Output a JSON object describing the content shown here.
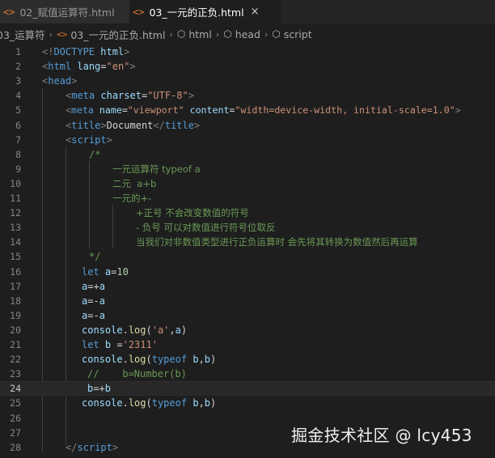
{
  "tabs": [
    {
      "label": "02_赋值运算符.html",
      "state": "inactive"
    },
    {
      "label": "03_一元的正负.html",
      "state": "active",
      "close": "×"
    }
  ],
  "breadcrumb": {
    "folder": "03_运算符",
    "file": "03_一元的正负.html",
    "items": [
      "html",
      "head",
      "script"
    ]
  },
  "icons": {
    "html_file": "<>",
    "symbol_cube": "⬡",
    "separator": "›"
  },
  "line_numbers": [
    "1",
    "2",
    "3",
    "4",
    "5",
    "6",
    "7",
    "8",
    "9",
    "10",
    "11",
    "12",
    "13",
    "14",
    "15",
    "16",
    "17",
    "18",
    "19",
    "20",
    "21",
    "22",
    "23",
    "24",
    "25",
    "26",
    "27",
    "28"
  ],
  "current_line": "24",
  "code": {
    "l1": {
      "open": "<!",
      "tag": "DOCTYPE",
      "rest": " html",
      "close": ">"
    },
    "l2": {
      "open": "<",
      "tag": "html",
      "attr": "lang",
      "eq": "=",
      "val": "\"en\"",
      "close": ">"
    },
    "l3": {
      "open": "<",
      "tag": "head",
      "close": ">"
    },
    "l4": {
      "open": "<",
      "tag": "meta",
      "attr": "charset",
      "eq": "=",
      "val": "\"UTF-8\"",
      "close": ">"
    },
    "l5": {
      "open": "<",
      "tag": "meta",
      "attr1": "name",
      "eq1": "=",
      "val1": "\"viewport\"",
      "attr2": "content",
      "eq2": "=",
      "val2": "\"width=device-width, initial-scale=1.0\"",
      "close": ">"
    },
    "l6": {
      "open": "<",
      "tag": "title",
      "close": ">",
      "text": "Document",
      "open2": "</",
      "tag2": "title",
      "close2": ">"
    },
    "l7": {
      "open": "<",
      "tag": "script",
      "close": ">"
    },
    "l8": "/*",
    "l9": "一元运算符 typeof a",
    "l10": "二元  a+b",
    "l11": "一元的+-",
    "l12": "+正号 不会改变数值的符号",
    "l13": "- 负号 可以对数值进行符号位取反",
    "l14": "当我们对非数值类型进行正负运算时 会先将其转换为数值然后再运算",
    "l15": "*/",
    "l16": {
      "kw": "let",
      "var": "a",
      "op": "=",
      "num": "10"
    },
    "l17": {
      "var": "a",
      "op": "=+",
      "var2": "a"
    },
    "l18": {
      "var": "a",
      "op": "=-",
      "var2": "a"
    },
    "l19": {
      "var": "a",
      "op": "=-",
      "var2": "a"
    },
    "l20": {
      "obj": "console",
      "dot": ".",
      "fn": "log",
      "p1": "(",
      "str": "'a'",
      "comma": ",",
      "var": "a",
      "p2": ")"
    },
    "l21": {
      "kw": "let",
      "var": "b",
      "op": " =",
      "str": "'2311'"
    },
    "l22": {
      "obj": "console",
      "dot": ".",
      "fn": "log",
      "p1": "(",
      "kw": "typeof",
      "sp": " ",
      "var": "b",
      "comma": ",",
      "var2": "b",
      "p2": ")"
    },
    "l23": "//    b=Number(b)",
    "l24": {
      "var": "b",
      "op": "=+",
      "var2": "b"
    },
    "l25": {
      "obj": "console",
      "dot": ".",
      "fn": "log",
      "p1": "(",
      "kw": "typeof",
      "sp": " ",
      "var": "b",
      "comma": ",",
      "var2": "b",
      "p2": ")"
    },
    "l28": {
      "open": "</",
      "tag": "script",
      "close": ">"
    }
  },
  "watermark": "掘金技术社区 @ lcy453",
  "colors": {
    "background": "#1e1e1e",
    "tag": "#569cd6",
    "attribute": "#9cdcfe",
    "string": "#ce9178",
    "comment": "#6a9955",
    "function": "#dcdcaa",
    "number": "#b5cea8",
    "file_icon": "#e37933"
  }
}
